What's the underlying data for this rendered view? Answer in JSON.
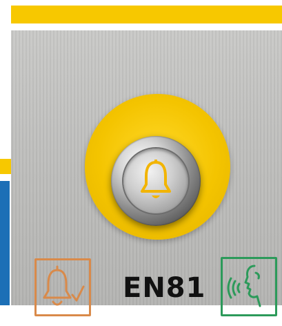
{
  "panel_label": "EN81",
  "icons": {
    "main_button": "bell-icon",
    "left_pictogram": "bell-acknowledged-icon",
    "right_pictogram": "voice-communication-icon"
  },
  "colors": {
    "accent_yellow": "#f7c800",
    "panel_gray": "#c4c4c2",
    "bell_yellow": "#f2b400",
    "pictogram_orange": "#d98a4a",
    "pictogram_green": "#2c9a5a",
    "side_blue": "#1c6fb6"
  }
}
